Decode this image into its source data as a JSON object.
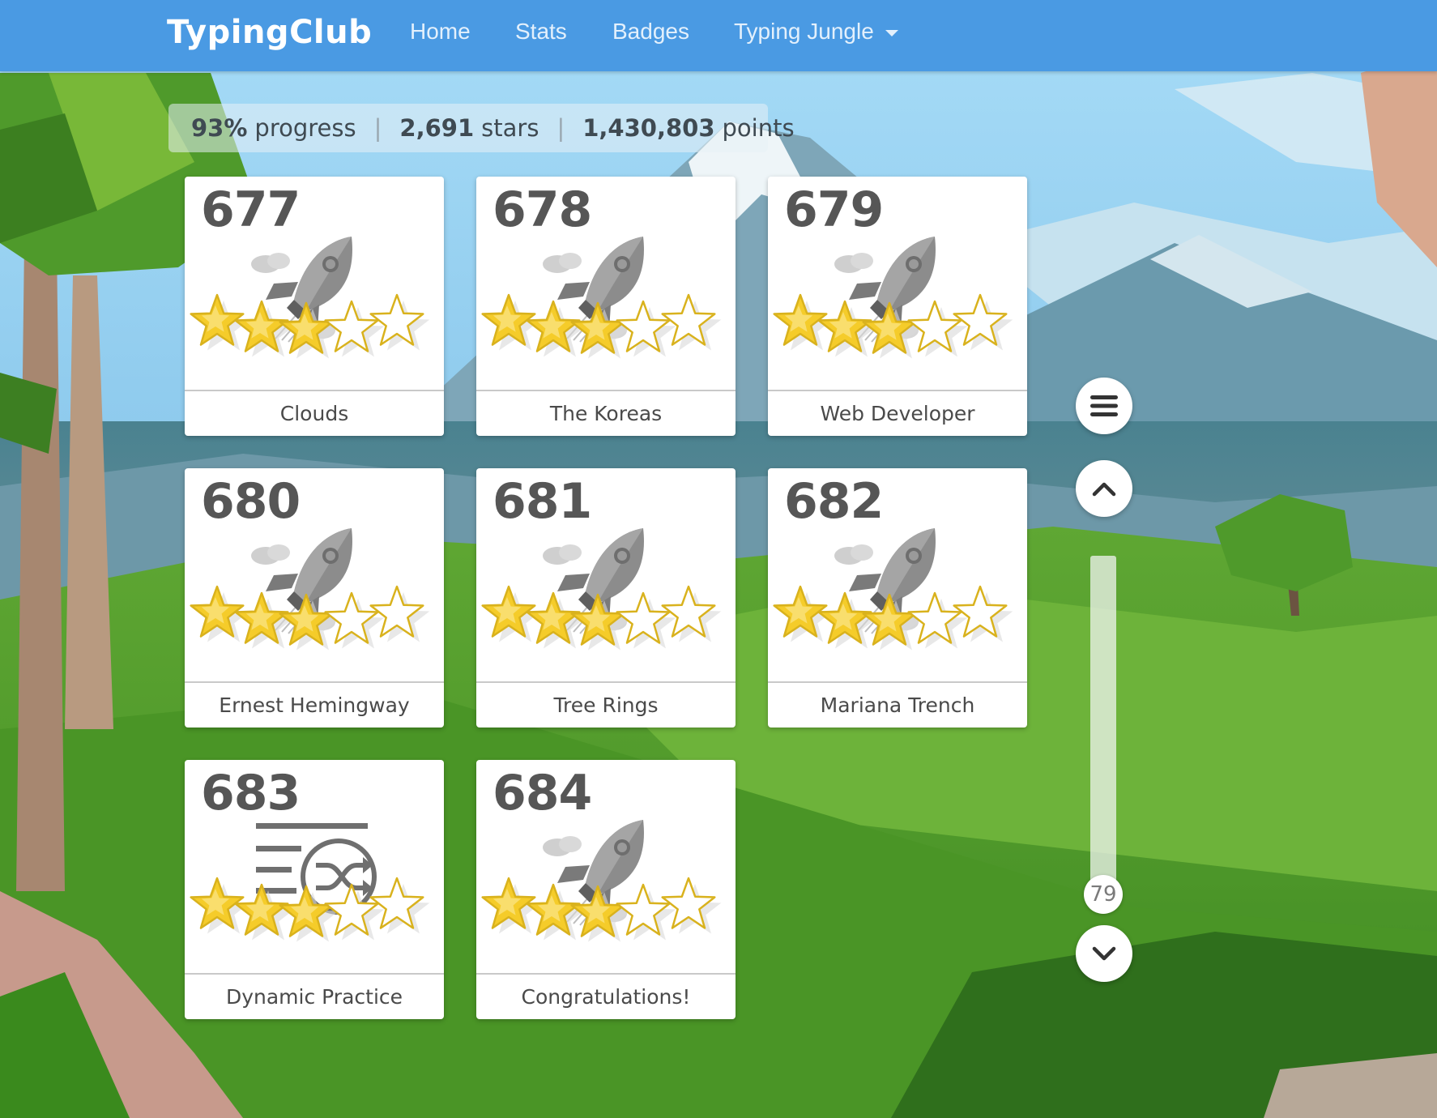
{
  "navbar": {
    "brand": "TypingClub",
    "links": [
      {
        "label": "Home"
      },
      {
        "label": "Stats"
      },
      {
        "label": "Badges"
      },
      {
        "label": "Typing Jungle"
      }
    ]
  },
  "stats": {
    "progress_value": "93%",
    "progress_label": "progress",
    "stars_value": "2,691",
    "stars_label": "stars",
    "points_value": "1,430,803",
    "points_label": "points",
    "separator": "|"
  },
  "lessons": [
    {
      "number": "677",
      "title": "Clouds",
      "icon": "rocket-icon",
      "stars_earned": 3,
      "stars_total": 5
    },
    {
      "number": "678",
      "title": "The Koreas",
      "icon": "rocket-icon",
      "stars_earned": 3,
      "stars_total": 5
    },
    {
      "number": "679",
      "title": "Web Developer",
      "icon": "rocket-icon",
      "stars_earned": 3,
      "stars_total": 5
    },
    {
      "number": "680",
      "title": "Ernest Hemingway",
      "icon": "rocket-icon",
      "stars_earned": 3,
      "stars_total": 5
    },
    {
      "number": "681",
      "title": "Tree Rings",
      "icon": "rocket-icon",
      "stars_earned": 3,
      "stars_total": 5
    },
    {
      "number": "682",
      "title": "Mariana Trench",
      "icon": "rocket-icon",
      "stars_earned": 3,
      "stars_total": 5
    },
    {
      "number": "683",
      "title": "Dynamic Practice",
      "icon": "shuffle-icon",
      "stars_earned": 3,
      "stars_total": 5
    },
    {
      "number": "684",
      "title": "Congratulations!",
      "icon": "rocket-icon",
      "stars_earned": 3,
      "stars_total": 5
    }
  ],
  "controls": {
    "menu_icon": "hamburger-menu-icon",
    "up_icon": "chevron-up-icon",
    "down_icon": "chevron-down-icon",
    "scroll_position_label": "79"
  },
  "colors": {
    "navbar": "#4a9ae3",
    "star_fill": "#f5cc2a",
    "star_outline": "#d9b21d",
    "icon_gray": "#8c8c8c",
    "card_text": "#565656"
  }
}
